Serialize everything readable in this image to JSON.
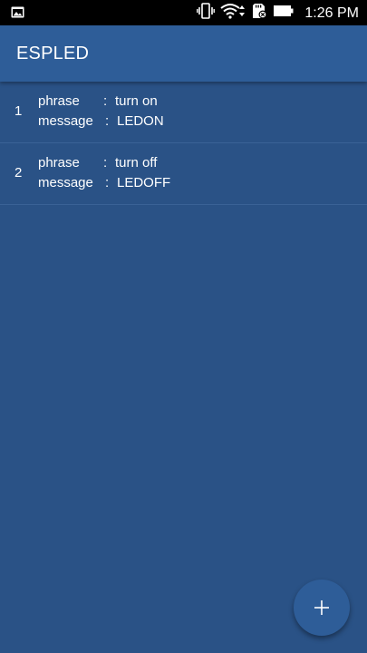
{
  "status_bar": {
    "time": "1:26 PM",
    "icons": [
      "image-icon",
      "vibrate-icon",
      "wifi-icon",
      "sd-card-icon",
      "battery-icon"
    ]
  },
  "app_bar": {
    "title": "ESPLED"
  },
  "list": {
    "items": [
      {
        "index": "1",
        "phrase_label": "phrase",
        "phrase_sep": ":",
        "phrase_value": "turn on",
        "message_label": "message",
        "message_sep": ":",
        "message_value": "LEDON"
      },
      {
        "index": "2",
        "phrase_label": "phrase",
        "phrase_sep": ":",
        "phrase_value": "turn off",
        "message_label": "message",
        "message_sep": ":",
        "message_value": "LEDOFF"
      }
    ]
  },
  "fab": {
    "icon": "plus-icon"
  },
  "colors": {
    "background": "#2a5286",
    "app_bar": "#2e5d98",
    "status_bar": "#000000",
    "text": "#ffffff"
  }
}
